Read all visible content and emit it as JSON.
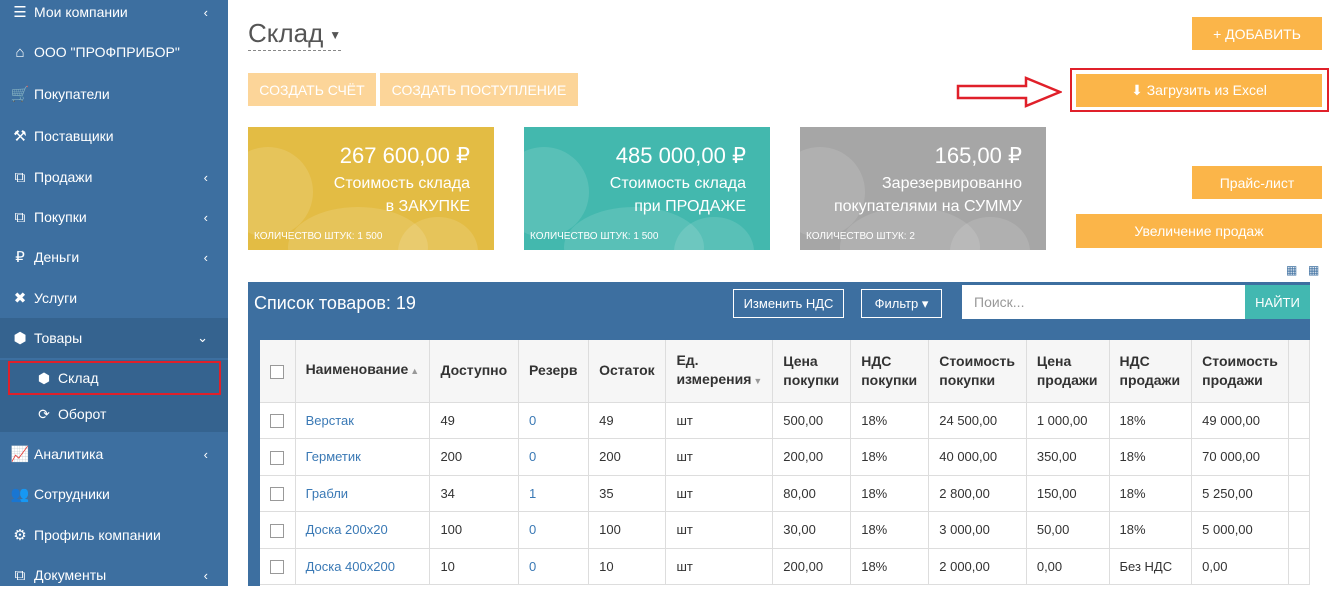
{
  "sidebar": {
    "items": [
      {
        "icon": "list-icon",
        "glyph": "☰",
        "label": "Мои компании",
        "chevron": "‹"
      },
      {
        "icon": "home-icon",
        "glyph": "⌂",
        "label": "ООО \"ПРОФПРИБОР\"",
        "chevron": ""
      },
      {
        "icon": "cart-icon",
        "glyph": "🛒",
        "label": "Покупатели",
        "chevron": ""
      },
      {
        "icon": "truck-icon",
        "glyph": "⚒",
        "label": "Поставщики",
        "chevron": ""
      },
      {
        "icon": "sales-icon",
        "glyph": "⧉",
        "label": "Продажи",
        "chevron": "‹"
      },
      {
        "icon": "purchases-icon",
        "glyph": "⧉",
        "label": "Покупки",
        "chevron": "‹"
      },
      {
        "icon": "ruble-icon",
        "glyph": "₽",
        "label": "Деньги",
        "chevron": "‹"
      },
      {
        "icon": "tools-icon",
        "glyph": "✖",
        "label": "Услуги",
        "chevron": ""
      },
      {
        "icon": "cubes-icon",
        "glyph": "⬢",
        "label": "Товары",
        "chevron": "⌄"
      }
    ],
    "subitems": [
      {
        "icon": "cubes-icon",
        "glyph": "⬢",
        "label": "Склад"
      },
      {
        "icon": "refresh-icon",
        "glyph": "⟳",
        "label": "Оборот"
      }
    ],
    "bottom_items": [
      {
        "icon": "chart-icon",
        "glyph": "📈",
        "label": "Аналитика",
        "chevron": "‹"
      },
      {
        "icon": "users-icon",
        "glyph": "👥",
        "label": "Сотрудники",
        "chevron": ""
      },
      {
        "icon": "gear-icon",
        "glyph": "⚙",
        "label": "Профиль компании",
        "chevron": ""
      },
      {
        "icon": "docs-icon",
        "glyph": "⧉",
        "label": "Документы",
        "chevron": "‹"
      }
    ]
  },
  "page": {
    "title": "Склад",
    "create_invoice": "СОЗДАТЬ СЧЁТ",
    "create_receipt": "СОЗДАТЬ ПОСТУПЛЕНИЕ",
    "add": "+ ДОБАВИТЬ",
    "upload_excel": "⬇ Загрузить из Excel",
    "price_list": "Прайс-лист",
    "increase_sales": "Увеличение продаж"
  },
  "cards": [
    {
      "amount": "267 600,00 ₽",
      "line1": "Стоимость склада",
      "line2": "в ЗАКУПКЕ",
      "qty": "КОЛИЧЕСТВО ШТУК: 1 500",
      "color": "#e3bc44"
    },
    {
      "amount": "485 000,00 ₽",
      "line1": "Стоимость склада",
      "line2": "при ПРОДАЖЕ",
      "qty": "КОЛИЧЕСТВО ШТУК: 1 500",
      "color": "#43b8ae"
    },
    {
      "amount": "165,00 ₽",
      "line1": "Зарезервированно",
      "line2": "покупателями на СУММУ",
      "qty": "КОЛИЧЕСТВО ШТУК: 2",
      "color": "#a6a6a6"
    }
  ],
  "list": {
    "title": "Список товаров: 19",
    "change_vat": "Изменить НДС",
    "filter": "Фильтр ▾",
    "search_placeholder": "Поиск...",
    "search_button": "НАЙТИ"
  },
  "table": {
    "headers": [
      "Наименование",
      "Доступно",
      "Резерв",
      "Остаток",
      "Ед. измерения",
      "Цена покупки",
      "НДС покупки",
      "Стоимость покупки",
      "Цена продажи",
      "НДС продажи",
      "Стоимость продажи"
    ],
    "rows": [
      [
        "Верстак",
        "49",
        "0",
        "49",
        "шт",
        "500,00",
        "18%",
        "24 500,00",
        "1 000,00",
        "18%",
        "49 000,00"
      ],
      [
        "Герметик",
        "200",
        "0",
        "200",
        "шт",
        "200,00",
        "18%",
        "40 000,00",
        "350,00",
        "18%",
        "70 000,00"
      ],
      [
        "Грабли",
        "34",
        "1",
        "35",
        "шт",
        "80,00",
        "18%",
        "2 800,00",
        "150,00",
        "18%",
        "5 250,00"
      ],
      [
        "Доска 200х20",
        "100",
        "0",
        "100",
        "шт",
        "30,00",
        "18%",
        "3 000,00",
        "50,00",
        "18%",
        "5 000,00"
      ],
      [
        "Доска 400х200",
        "10",
        "0",
        "10",
        "шт",
        "200,00",
        "18%",
        "2 000,00",
        "0,00",
        "Без НДС",
        "0,00"
      ]
    ]
  }
}
